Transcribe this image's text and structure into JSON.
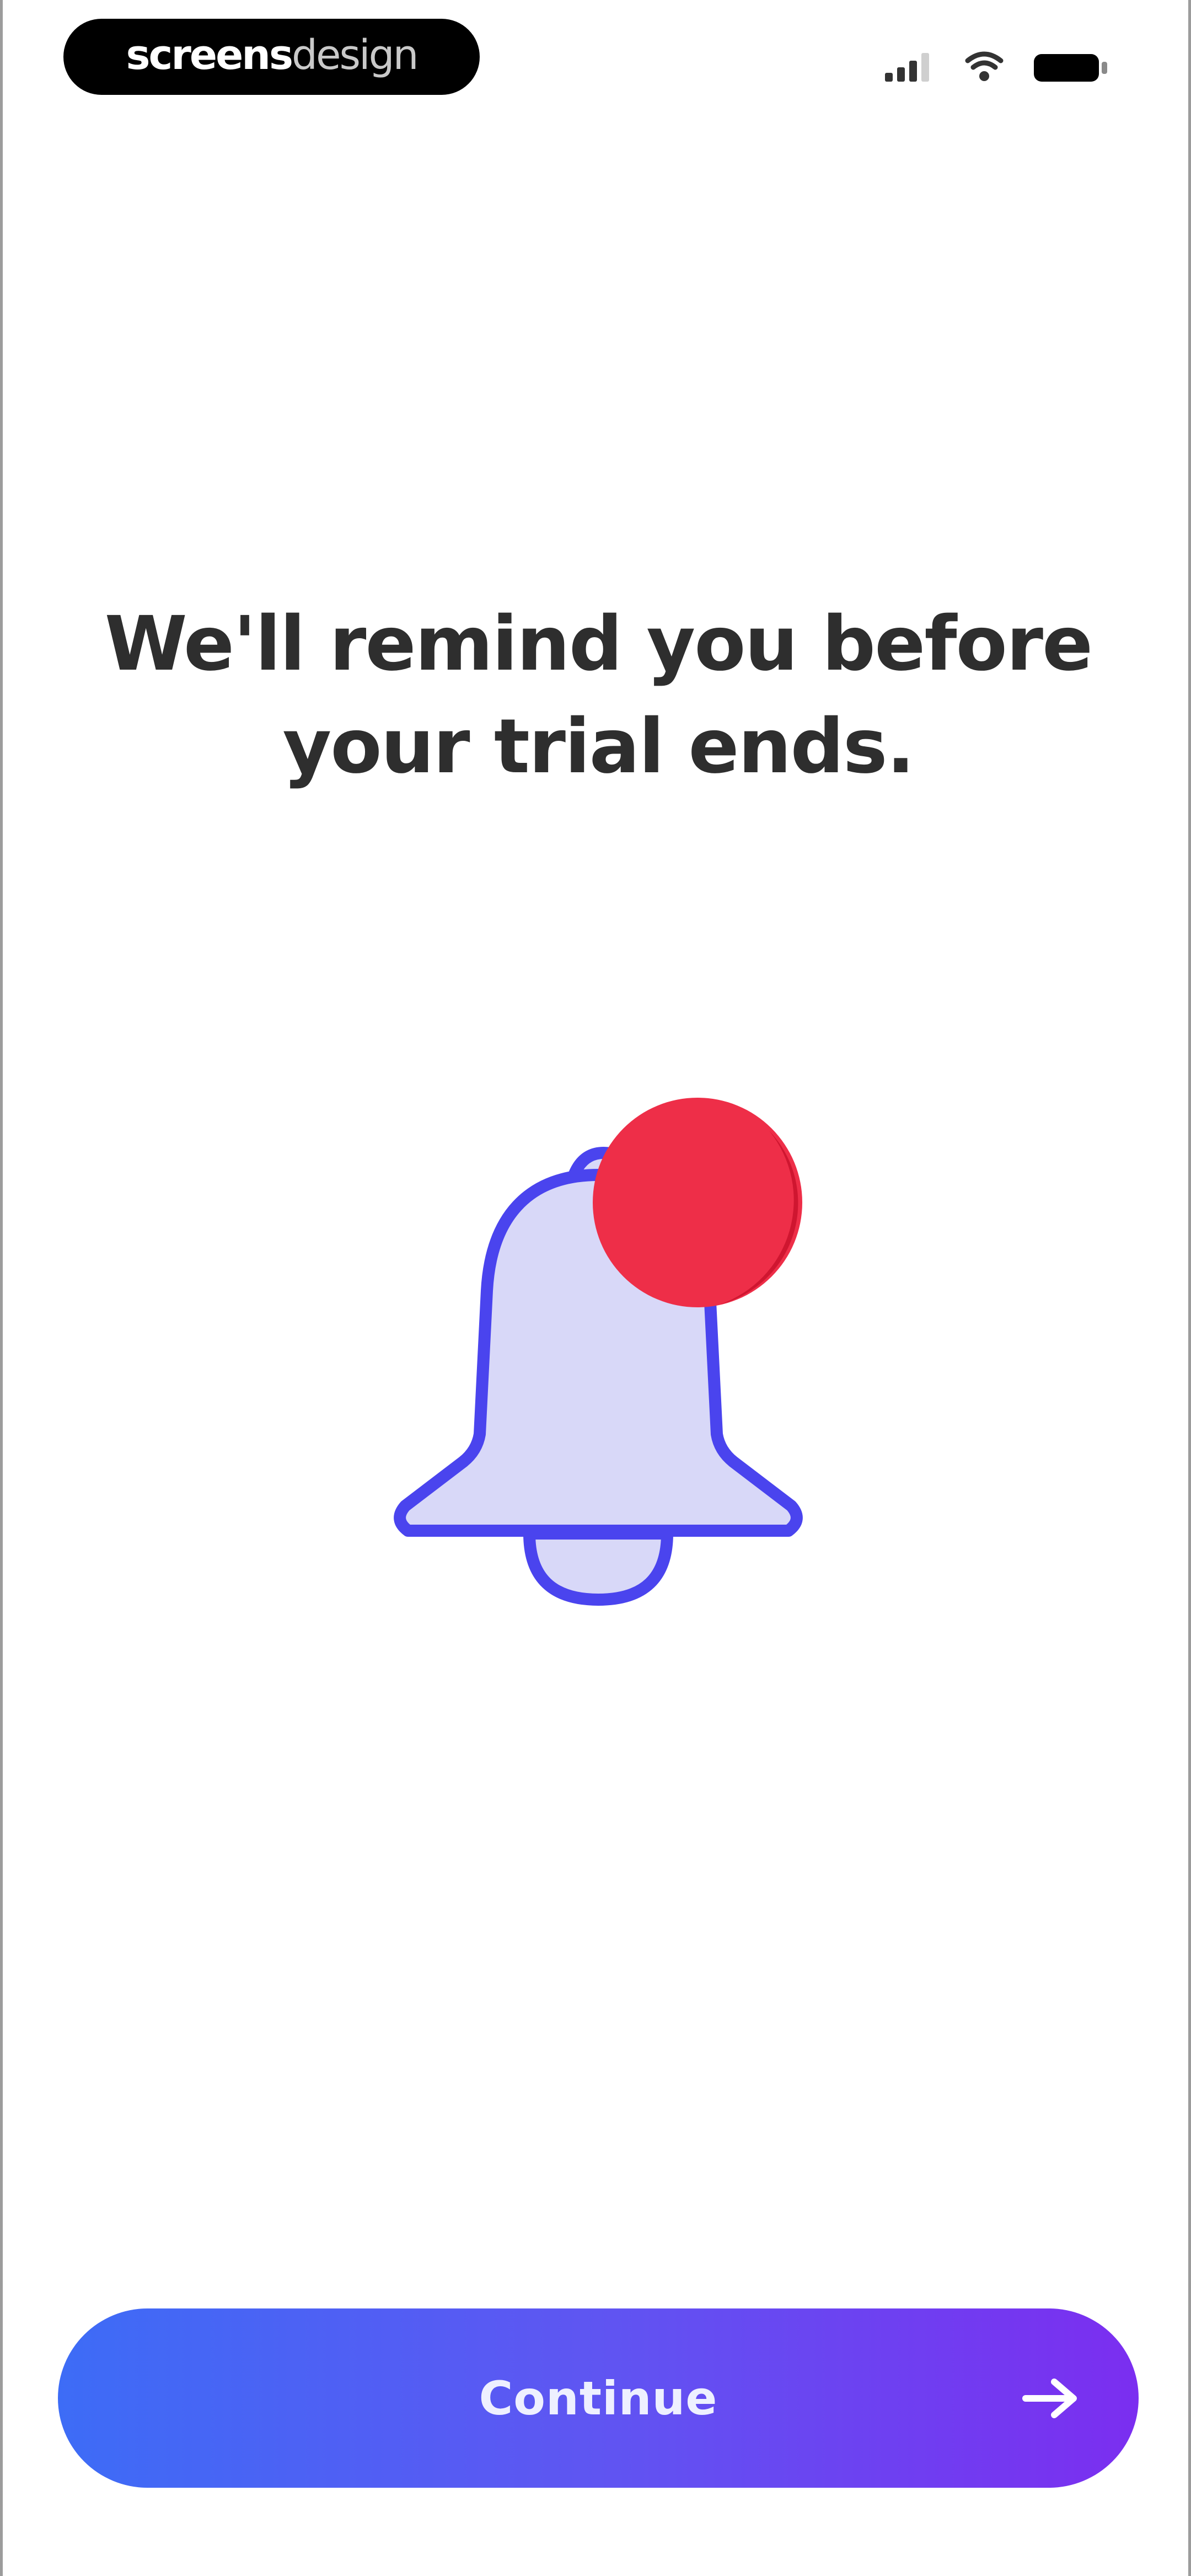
{
  "status_bar": {
    "brand_strong": "screens",
    "brand_light": "design",
    "icons": [
      "signal-icon",
      "wifi-icon",
      "battery-icon"
    ]
  },
  "headline": {
    "line1": "We'll remind you before",
    "line2": "your trial ends."
  },
  "illustration": {
    "icon": "notification-bell-icon",
    "colors": {
      "bell_fill": "#d8d8f8",
      "bell_outline": "#4a44ee",
      "badge": "#ee2e48"
    }
  },
  "continue": {
    "label": "Continue",
    "icon": "arrow-right-icon",
    "gradient": [
      "#3d6cf6",
      "#7b2ef0"
    ]
  }
}
